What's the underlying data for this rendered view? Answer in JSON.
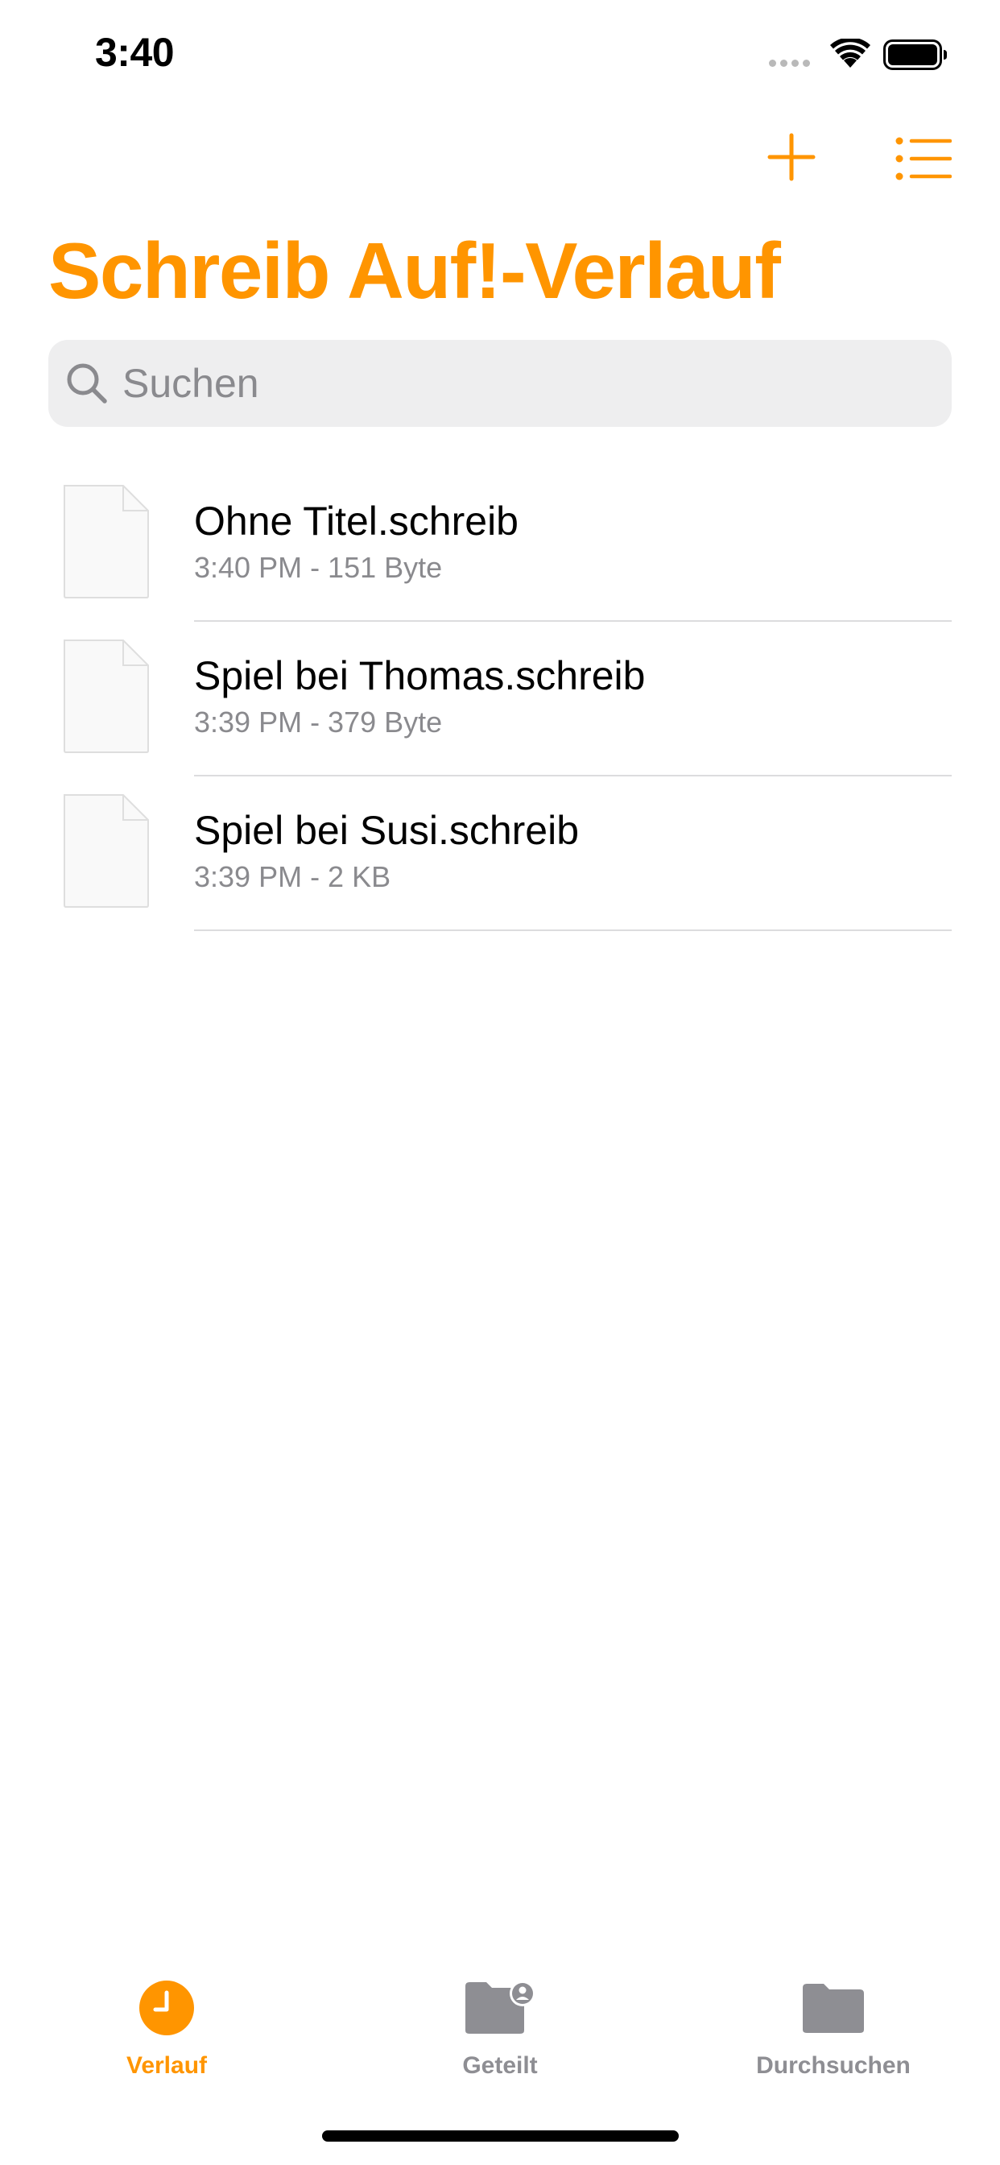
{
  "status_bar": {
    "time": "3:40"
  },
  "colors": {
    "accent": "#FF9500",
    "secondary_text": "#8A8A8E",
    "search_background": "#EEEEEF",
    "inactive_tab": "#8E8E93"
  },
  "nav": {
    "add_icon": "plus-icon",
    "list_icon": "list-icon"
  },
  "page": {
    "title": "Schreib Auf!-Verlauf"
  },
  "search": {
    "placeholder": "Suchen",
    "value": ""
  },
  "files": [
    {
      "name": "Ohne Titel.schreib",
      "meta": "3:40 PM - 151 Byte",
      "icon": "document-icon"
    },
    {
      "name": "Spiel bei Thomas.schreib",
      "meta": "3:39 PM - 379 Byte",
      "icon": "document-icon"
    },
    {
      "name": "Spiel bei Susi.schreib",
      "meta": "3:39 PM - 2 KB",
      "icon": "document-icon"
    }
  ],
  "tabs": [
    {
      "label": "Verlauf",
      "icon": "clock-icon",
      "active": true
    },
    {
      "label": "Geteilt",
      "icon": "shared-folder-icon",
      "active": false
    },
    {
      "label": "Durchsuchen",
      "icon": "folder-icon",
      "active": false
    }
  ]
}
